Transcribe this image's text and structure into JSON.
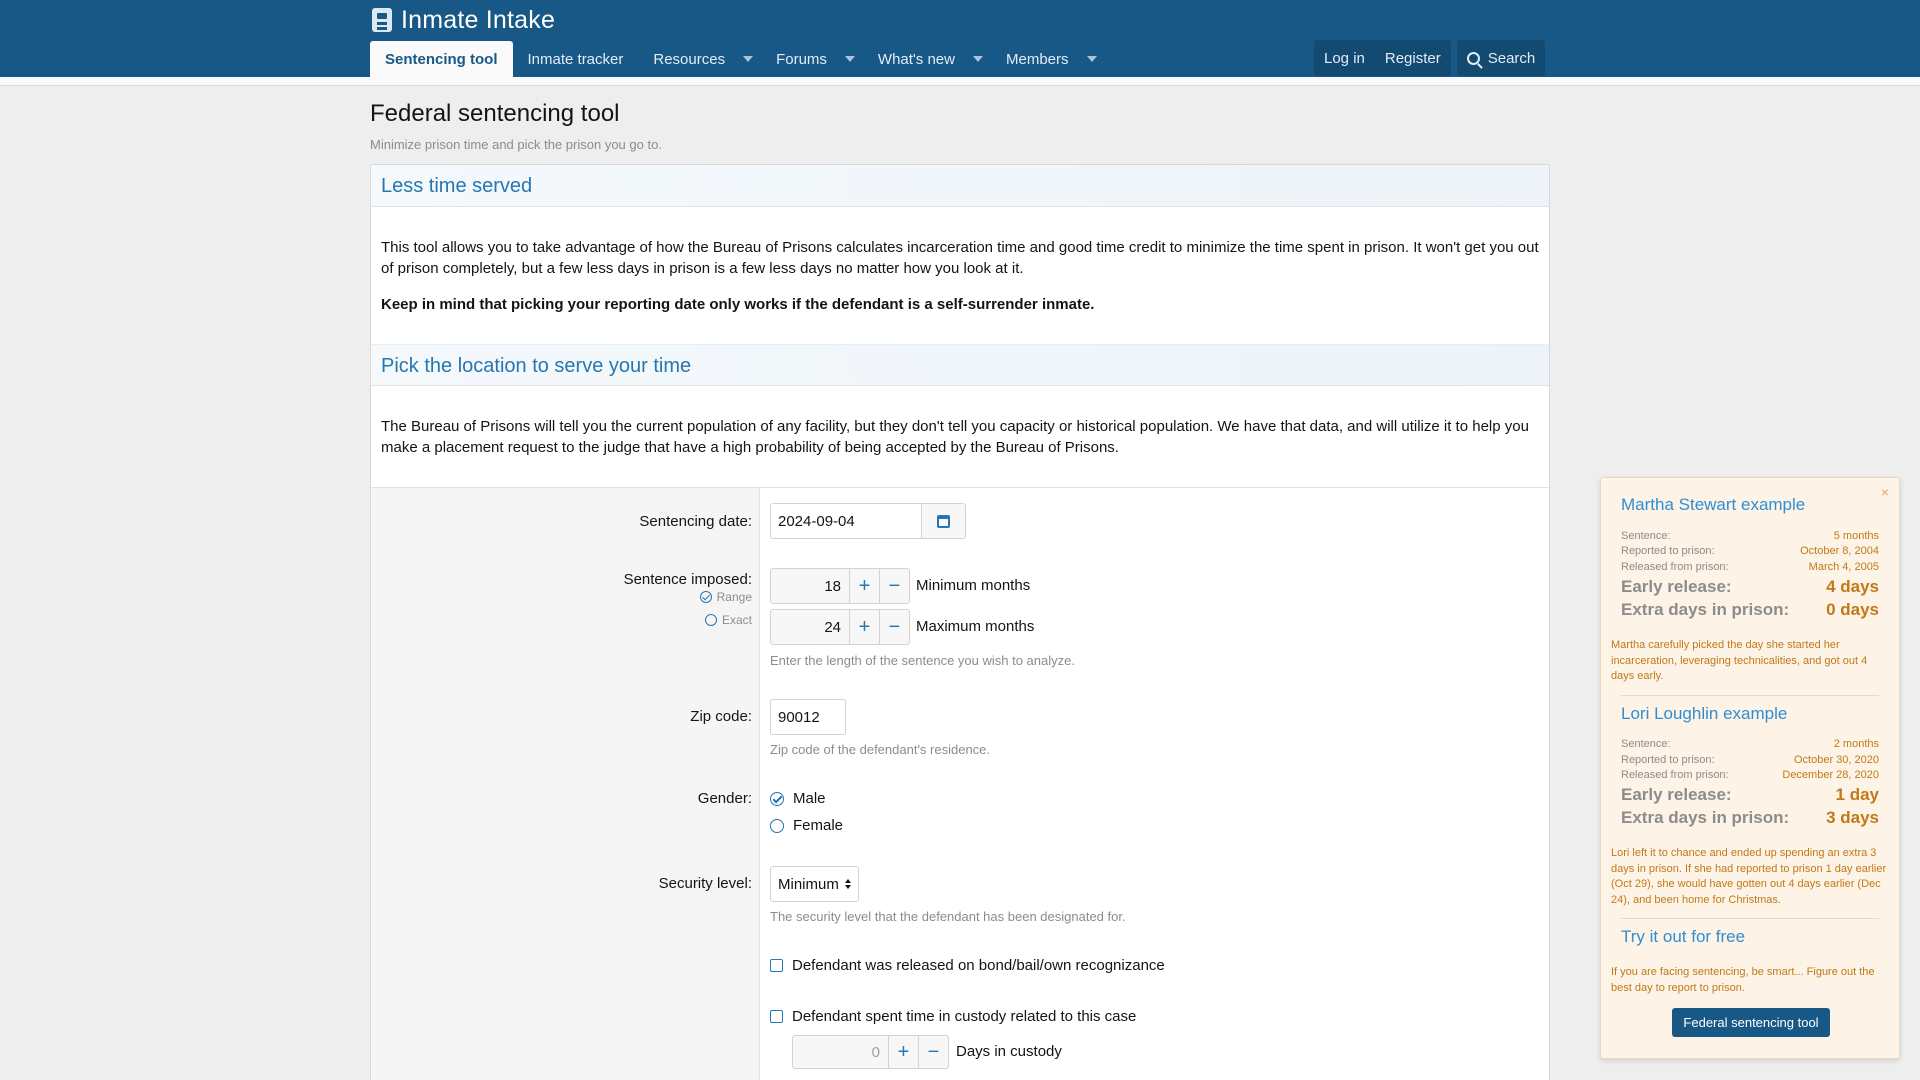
{
  "header": {
    "site_name": "Inmate Intake",
    "nav": [
      {
        "label": "Sentencing tool",
        "active": true
      },
      {
        "label": "Inmate tracker"
      },
      {
        "label": "Resources",
        "dropdown": true
      },
      {
        "label": "Forums",
        "dropdown": true
      },
      {
        "label": "What's new",
        "dropdown": true
      },
      {
        "label": "Members",
        "dropdown": true
      }
    ],
    "login_label": "Log in",
    "register_label": "Register",
    "search_label": "Search"
  },
  "page": {
    "title": "Federal sentencing tool",
    "description": "Minimize prison time and pick the prison you go to."
  },
  "section1": {
    "title": "Less time served",
    "para": "This tool allows you to take advantage of how the Bureau of Prisons calculates incarceration time and good time credit to minimize the time spent in prison. It won't get you out of prison completely, but a few less days in prison is a few less days no matter how you look at it.",
    "bold": "Keep in mind that picking your reporting date only works if the defendant is a self-surrender inmate."
  },
  "section2": {
    "title": "Pick the location to serve your time",
    "para": "The Bureau of Prisons will tell you the current population of any facility, but they don't tell you capacity or historical population. We have that data, and will utilize it to help you make a placement request to the judge that have a high probability of being accepted by the Bureau of Prisons."
  },
  "form": {
    "sentencing_date_label": "Sentencing date:",
    "sentencing_date_value": "2024-09-04",
    "sentence_imposed_label": "Sentence imposed:",
    "mode_range": "Range",
    "mode_exact": "Exact",
    "min_value": "18",
    "min_label": "Minimum months",
    "max_value": "24",
    "max_label": "Maximum months",
    "sentence_hint": "Enter the length of the sentence you wish to analyze.",
    "zip_label": "Zip code:",
    "zip_value": "90012",
    "zip_hint": "Zip code of the defendant's residence.",
    "gender_label": "Gender:",
    "gender_male": "Male",
    "gender_female": "Female",
    "security_label": "Security level:",
    "security_value": "Minimum",
    "security_hint": "The security level that the defendant has been designated for.",
    "bond_label": "Defendant was released on bond/bail/own recognizance",
    "custody_label": "Defendant spent time in custody related to this case",
    "custody_days_value": "0",
    "custody_days_label": "Days in custody"
  },
  "popup": {
    "close": "×",
    "ex1": {
      "title": "Martha Stewart example",
      "rows": [
        {
          "k": "Sentence:",
          "v": "5 months"
        },
        {
          "k": "Reported to prison:",
          "v": "October 8, 2004"
        },
        {
          "k": "Released from prison:",
          "v": "March 4, 2005"
        }
      ],
      "early_k": "Early release:",
      "early_v": "4 days",
      "extra_k": "Extra days in prison:",
      "extra_v": "0 days",
      "note": "Martha carefully picked the day she started her incarceration, leveraging technicalities, and got out 4 days early."
    },
    "ex2": {
      "title": "Lori Loughlin example",
      "rows": [
        {
          "k": "Sentence:",
          "v": "2 months"
        },
        {
          "k": "Reported to prison:",
          "v": "October 30, 2020"
        },
        {
          "k": "Released from prison:",
          "v": "December 28, 2020"
        }
      ],
      "early_k": "Early release:",
      "early_v": "1 day",
      "extra_k": "Extra days in prison:",
      "extra_v": "3 days",
      "note": "Lori left it to chance and ended up spending an extra 3 days in prison. If she had reported to prison 1 day earlier (Oct 29), she would have gotten out 4 days earlier (Dec 24), and been home for Christmas."
    },
    "try_title": "Try it out for free",
    "try_note": "If you are facing sentencing, be smart... Figure out the best day to report to prison.",
    "button": "Federal sentencing tool"
  }
}
